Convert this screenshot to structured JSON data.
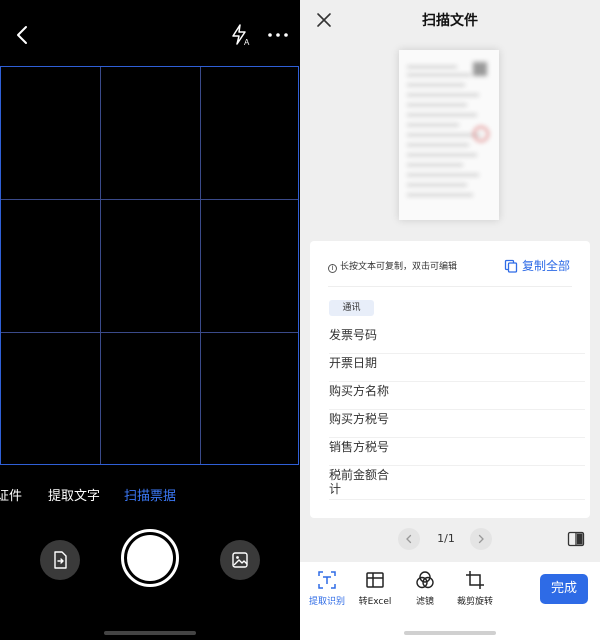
{
  "camera": {
    "modes": [
      "证件",
      "提取文字",
      "扫描票据"
    ],
    "active_mode": "扫描票据",
    "accent_color": "#3b78f5",
    "icons": {
      "back": "chevron-left-icon",
      "flash": "flash-auto-icon",
      "more": "more-dots-icon",
      "import": "import-file-icon",
      "shutter": "shutter-icon",
      "gallery": "gallery-icon"
    }
  },
  "scan": {
    "title": "扫描文件",
    "tip": "长按文本可复制，双击可编辑",
    "copy_all": "复制全部",
    "tag": "通讯",
    "fields": [
      {
        "label": "发票号码"
      },
      {
        "label": "开票日期"
      },
      {
        "label": "购买方名称"
      },
      {
        "label": "购买方税号"
      },
      {
        "label": "销售方税号"
      },
      {
        "label": "税前金额合计"
      }
    ],
    "pager": {
      "text": "1/1"
    },
    "toolbar": {
      "tools": [
        {
          "label": "提取识别",
          "icon": "text-recognize-icon",
          "active": true
        },
        {
          "label": "转Excel",
          "icon": "excel-convert-icon",
          "active": false
        },
        {
          "label": "滤镜",
          "icon": "filter-icon",
          "active": false
        },
        {
          "label": "裁剪旋转",
          "icon": "crop-rotate-icon",
          "active": false
        }
      ],
      "done": "完成"
    },
    "accent_color": "#2e6be6"
  }
}
